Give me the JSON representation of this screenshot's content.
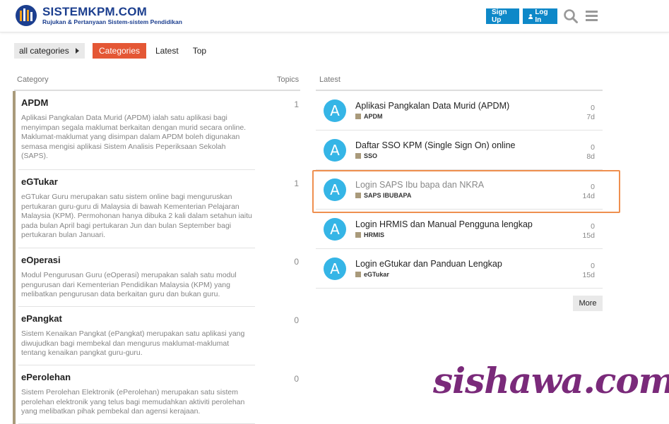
{
  "header": {
    "logo_title": "SISTEMKPM.COM",
    "logo_subtitle": "Rujukan & Pertanyaan Sistem-sistem Pendidikan",
    "signup_label": "Sign Up",
    "login_label": "Log In",
    "login_icon": "user-icon",
    "search_icon": "search-icon",
    "menu_icon": "hamburger-menu-icon"
  },
  "nav": {
    "dropdown_label": "all categories",
    "tabs": [
      {
        "label": "Categories",
        "active": true
      },
      {
        "label": "Latest",
        "active": false
      },
      {
        "label": "Top",
        "active": false
      }
    ]
  },
  "categories_table": {
    "col_category": "Category",
    "col_topics": "Topics",
    "rows": [
      {
        "name": "APDM",
        "count": "1",
        "description": "Aplikasi Pangkalan Data Murid (APDM) ialah satu aplikasi bagi menyimpan segala maklumat berkaitan dengan murid secara online. Maklumat-maklumat yang disimpan dalam APDM boleh digunakan semasa mengisi aplikasi Sistem Analisis Peperiksaan Sekolah (SAPS)."
      },
      {
        "name": "eGTukar",
        "count": "1",
        "description": "eGTukar Guru merupakan satu sistem online bagi menguruskan pertukaran guru-guru di Malaysia di bawah Kementerian Pelajaran Malaysia (KPM). Permohonan hanya dibuka 2 kali dalam setahun iaitu pada bulan April bagi pertukaran Jun dan bulan September bagi pertukaran bulan Januari."
      },
      {
        "name": "eOperasi",
        "count": "0",
        "description": "Modul Pengurusan Guru (eOperasi) merupakan salah satu modul pengurusan dari Kementerian Pendidikan Malaysia (KPM) yang melibatkan pengurusan data berkaitan guru dan bukan guru."
      },
      {
        "name": "ePangkat",
        "count": "0",
        "description": "Sistem Kenaikan Pangkat (ePangkat) merupakan satu aplikasi yang diwujudkan bagi membekal dan mengurus maklumat-maklumat tentang kenaikan pangkat guru-guru."
      },
      {
        "name": "ePerolehan",
        "count": "0",
        "description": "Sistem Perolehan Elektronik (ePerolehan) merupakan satu sistem perolehan elektronik yang telus bagi memudahkan aktiviti perolehan yang melibatkan pihak pembekal dan agensi kerajaan."
      }
    ]
  },
  "latest": {
    "heading": "Latest",
    "avatar_letter": "A",
    "topics": [
      {
        "title": "Aplikasi Pangkalan Data Murid (APDM)",
        "category": "APDM",
        "replies": "0",
        "age": "7d",
        "visited": false
      },
      {
        "title": "Daftar SSO KPM (Single Sign On) online",
        "category": "SSO",
        "replies": "0",
        "age": "8d",
        "visited": false
      },
      {
        "title": "Login SAPS Ibu bapa dan NKRA",
        "category": "SAPS IBUBAPA",
        "replies": "0",
        "age": "14d",
        "visited": true
      },
      {
        "title": "Login HRMIS dan Manual Pengguna lengkap",
        "category": "HRMIS",
        "replies": "0",
        "age": "15d",
        "visited": false
      },
      {
        "title": "Login eGtukar dan Panduan Lengkap",
        "category": "eGTukar",
        "replies": "0",
        "age": "15d",
        "visited": false
      }
    ],
    "more_label": "More"
  },
  "watermark": "sishawa.com",
  "colors": {
    "primary_button": "#0e88c8",
    "active_tab": "#e45735",
    "category_bar": "#a99a7b",
    "avatar": "#35b5e6",
    "highlight": "#ef8f4f",
    "watermark": "#7a2a7a"
  }
}
